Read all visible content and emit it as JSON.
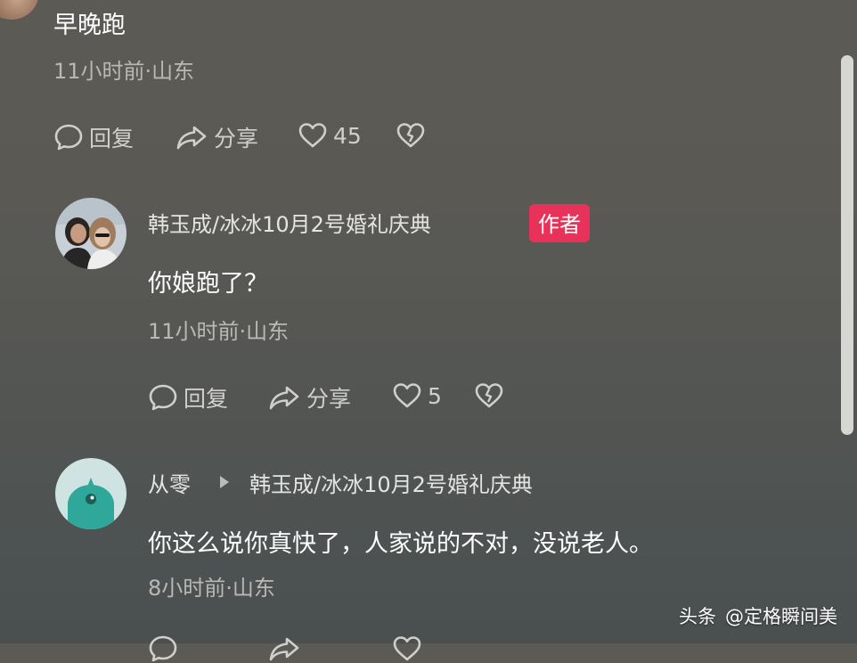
{
  "comment1": {
    "text": "早晚跑",
    "meta": "11小时前·山东",
    "actions": {
      "reply": "回复",
      "share": "分享",
      "likes": "45"
    }
  },
  "comment2": {
    "author": "韩玉成/冰冰10月2号婚礼庆典",
    "badge": "作者",
    "text": "你娘跑了？",
    "meta": "11小时前·山东",
    "actions": {
      "reply": "回复",
      "share": "分享",
      "likes": "5"
    }
  },
  "comment3": {
    "author": "从零",
    "reply_to": "韩玉成/冰冰10月2号婚礼庆典",
    "text": "你这么说你真快了，人家说的不对，没说老人。",
    "meta": "8小时前·山东"
  },
  "watermark": {
    "source": "头条",
    "account": "@定格瞬间美"
  },
  "colors": {
    "badge": "#e8325a",
    "avatar3": "#2fa79b"
  }
}
